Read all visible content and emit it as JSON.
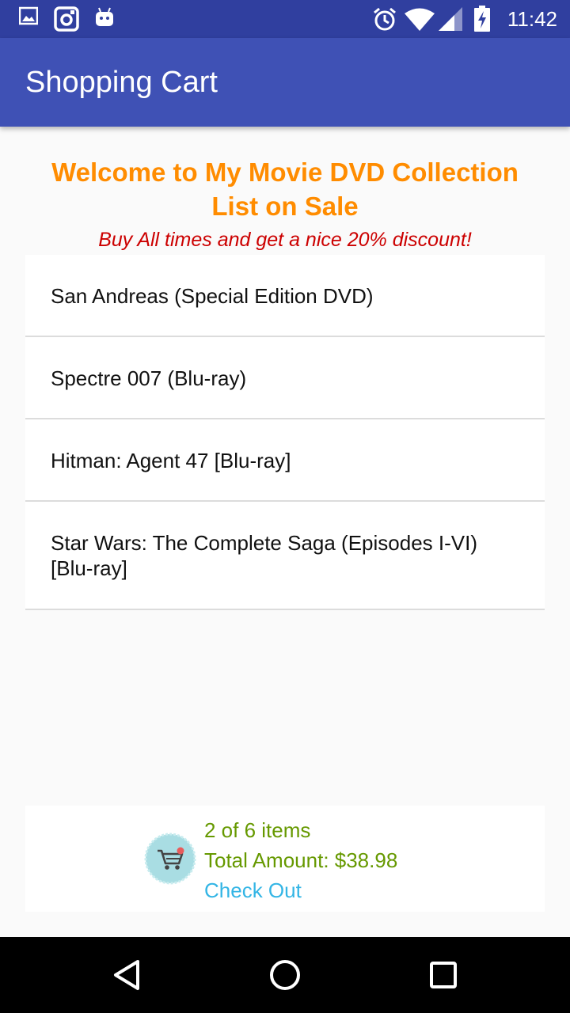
{
  "status_bar": {
    "time": "11:42",
    "left_icons": [
      "gallery-icon",
      "instagram-icon",
      "android-icon"
    ],
    "right_icons": [
      "alarm-icon",
      "wifi-icon",
      "signal-icon",
      "battery-charging-icon"
    ]
  },
  "app_bar": {
    "title": "Shopping Cart",
    "color": "#3f51b5"
  },
  "header": {
    "welcome_line1": "Welcome to My Movie DVD Collection",
    "welcome_line2": "List on Sale",
    "promo": "Buy All times and get a nice 20% discount!",
    "welcome_color": "#ff8c00",
    "promo_color": "#cc0000"
  },
  "products": [
    {
      "title": "San Andreas (Special Edition DVD)"
    },
    {
      "title": "Spectre 007 (Blu-ray)"
    },
    {
      "title": "Hitman: Agent 47 [Blu-ray]"
    },
    {
      "title": "Star Wars: The Complete Saga (Episodes I-VI) [Blu-ray]"
    }
  ],
  "cart": {
    "icon": "shopping-cart-icon",
    "count_text": "2 of 6 items",
    "total_text": "Total Amount: $38.98",
    "checkout_label": "Check Out",
    "text_color": "#669900",
    "link_color": "#33b5e5"
  },
  "nav_bar": {
    "buttons": [
      "back-icon",
      "home-icon",
      "recents-icon"
    ]
  }
}
